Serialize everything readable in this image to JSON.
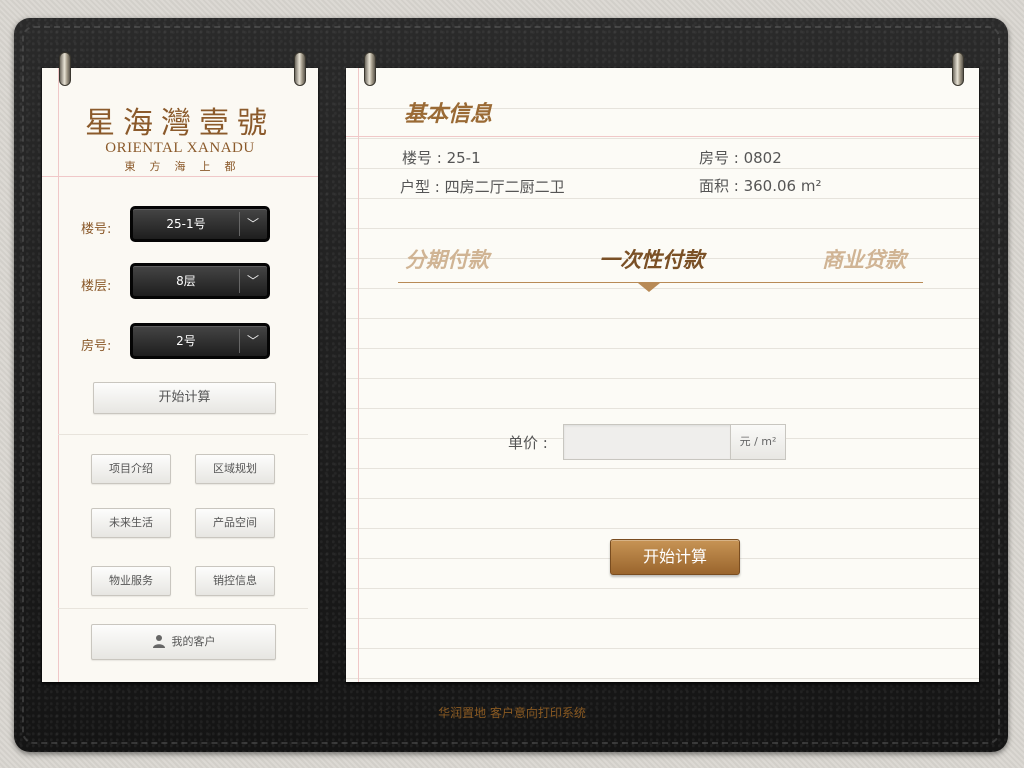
{
  "brand": {
    "name_cn": "星海灣壹號",
    "name_en": "ORIENTAL XANADU",
    "tagline": "東方海上都"
  },
  "selectors": {
    "building": {
      "label": "楼号:",
      "value": "25-1号"
    },
    "floor": {
      "label": "楼层:",
      "value": "8层"
    },
    "room": {
      "label": "房号:",
      "value": "2号"
    }
  },
  "sidebar": {
    "calc_label": "开始计算",
    "nav": [
      {
        "label": "项目介绍"
      },
      {
        "label": "区域规划"
      },
      {
        "label": "未来生活"
      },
      {
        "label": "产品空间"
      },
      {
        "label": "物业服务"
      },
      {
        "label": "销控信息"
      }
    ],
    "customer_label": "我的客户",
    "customer_icon": "user-icon"
  },
  "main": {
    "title": "基本信息",
    "info": {
      "building": "楼号 : 25-1",
      "room": "房号 : 0802",
      "layout": "户型 : 四房二厅二厨二卫",
      "area": "面积 : 360.06 m²"
    },
    "tabs": [
      {
        "label": "分期付款",
        "active": false
      },
      {
        "label": "一次性付款",
        "active": true
      },
      {
        "label": "商业贷款",
        "active": false
      }
    ],
    "price_label": "单价 :",
    "price_value": "",
    "price_unit": "元 / m²",
    "calc_label": "开始计算"
  },
  "footer": "华润置地  客户意向打印系统",
  "colors": {
    "accent": "#8b5a2b",
    "button_brown": "#b07a3f",
    "leather": "#1b1b1b"
  }
}
